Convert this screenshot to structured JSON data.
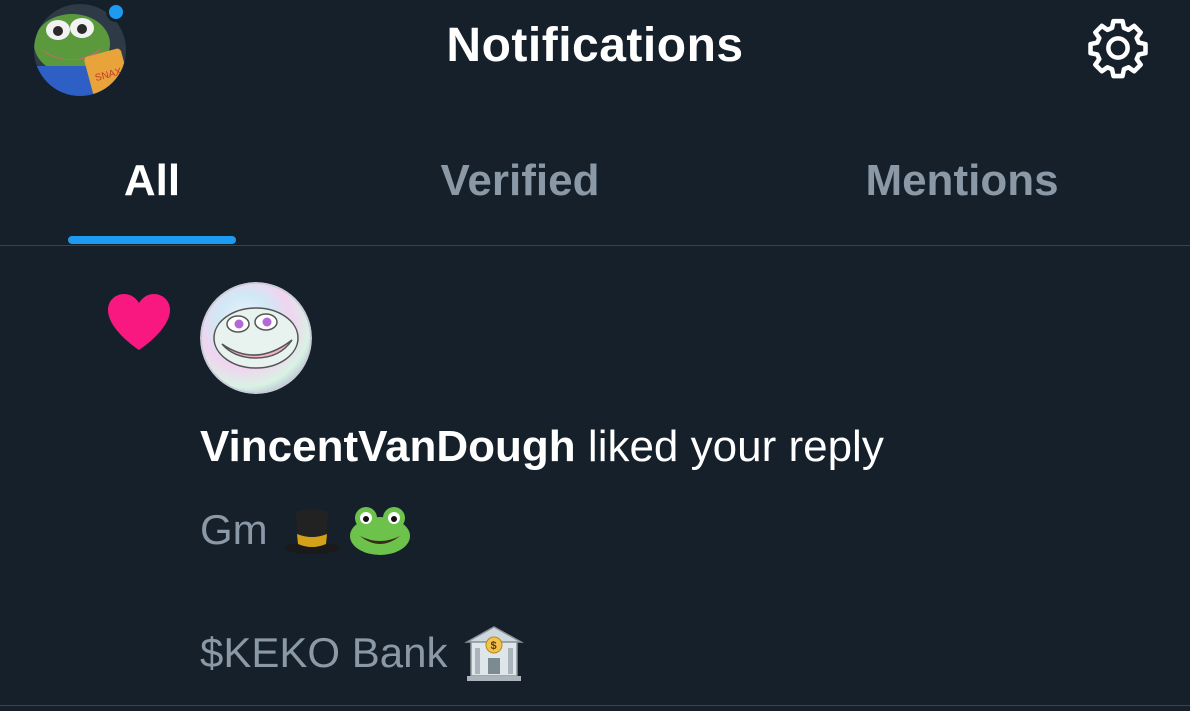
{
  "header": {
    "title": "Notifications",
    "avatar_icon": "frog-avatar-icon",
    "settings_icon": "gear-icon"
  },
  "tabs": [
    {
      "label": "All",
      "active": true
    },
    {
      "label": "Verified",
      "active": false
    },
    {
      "label": "Mentions",
      "active": false
    }
  ],
  "notification": {
    "type_icon": "heart-icon",
    "user": "VincentVanDough",
    "action": " liked your reply",
    "reply_line1": "Gm",
    "reply_line1_emojis": [
      "top-hat-emoji",
      "frog-emoji"
    ],
    "reply_line2": "$KEKO Bank",
    "reply_line2_emojis": [
      "bank-emoji"
    ]
  },
  "colors": {
    "background": "#15202b",
    "accent": "#1d9bf0",
    "heart": "#f91880",
    "muted_text": "#8b98a5",
    "divider": "#38444d"
  }
}
